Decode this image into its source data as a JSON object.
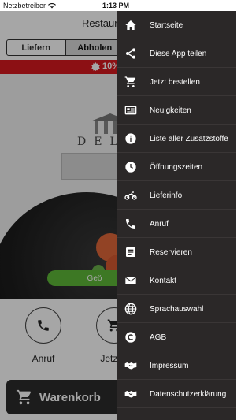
{
  "status_bar": {
    "carrier": "Netzbetreiber",
    "time": "1:13 PM"
  },
  "header": {
    "title": "Restaura"
  },
  "order_mode": {
    "options": [
      {
        "label": "Liefern",
        "active": false
      },
      {
        "label": "Abholen",
        "active": true
      }
    ]
  },
  "promo": {
    "text": "10%"
  },
  "hero": {
    "logo_text": "DEL",
    "green_button_label": "Geö"
  },
  "actions": [
    {
      "label": "Anruf",
      "icon": "phone-icon"
    },
    {
      "label": "Jetzt b",
      "icon": "cart-icon"
    }
  ],
  "cart": {
    "label": "Warenkorb"
  },
  "drawer": {
    "items": [
      {
        "label": "Startseite",
        "icon": "home-icon"
      },
      {
        "label": "Diese App teilen",
        "icon": "share-icon"
      },
      {
        "label": "Jetzt bestellen",
        "icon": "cart-icon"
      },
      {
        "label": "Neuigkeiten",
        "icon": "newspaper-icon"
      },
      {
        "label": "Liste aller Zusatzstoffe",
        "icon": "info-icon"
      },
      {
        "label": "Öffnungszeiten",
        "icon": "clock-icon"
      },
      {
        "label": "Lieferinfo",
        "icon": "motorcycle-icon"
      },
      {
        "label": "Anruf",
        "icon": "phone-icon"
      },
      {
        "label": "Reservieren",
        "icon": "list-icon"
      },
      {
        "label": "Kontakt",
        "icon": "envelope-icon"
      },
      {
        "label": "Sprachauswahl",
        "icon": "globe-icon"
      },
      {
        "label": "AGB",
        "icon": "copyright-icon"
      },
      {
        "label": "Impressum",
        "icon": "handshake-icon"
      },
      {
        "label": "Datenschutzerklärung",
        "icon": "handshake-icon"
      }
    ]
  },
  "colors": {
    "drawer_bg": "#2b2828",
    "promo_red": "#d71920",
    "accent_green": "#5fb838"
  }
}
